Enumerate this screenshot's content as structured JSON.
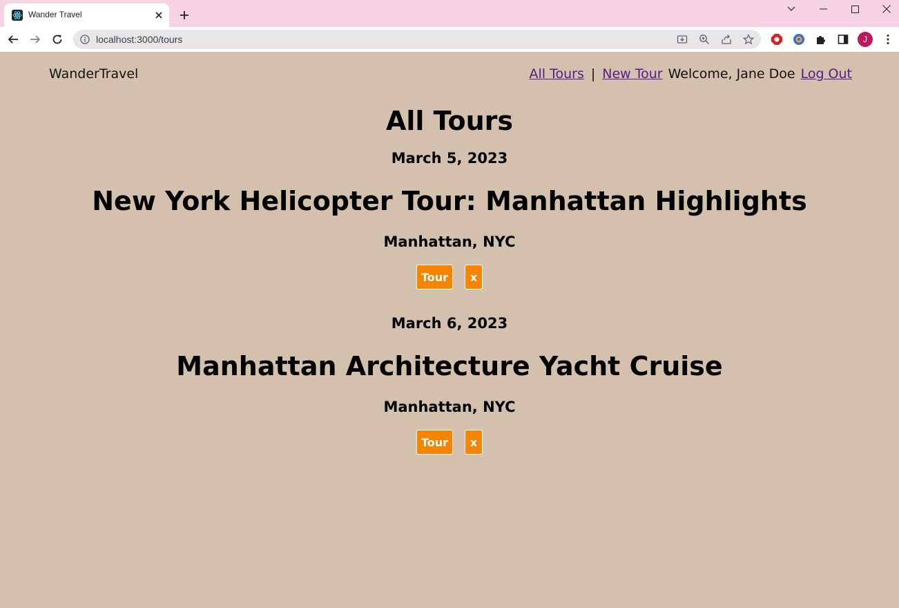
{
  "browser": {
    "tab_title": "Wander Travel",
    "url": "localhost:3000/tours",
    "avatar_initial": "J"
  },
  "header": {
    "brand": "WanderTravel",
    "nav_all_tours": "All Tours",
    "separator": "|",
    "nav_new_tour": "New Tour",
    "welcome": "Welcome, Jane Doe",
    "logout": "Log Out"
  },
  "main": {
    "title": "All Tours",
    "tours": [
      {
        "date": "March 5, 2023",
        "name": "New York Helicopter Tour: Manhattan Highlights",
        "location": "Manhattan, NYC",
        "tour_button": "Tour",
        "delete_button": "x"
      },
      {
        "date": "March 6, 2023",
        "name": "Manhattan Architecture Yacht Cruise",
        "location": "Manhattan, NYC",
        "tour_button": "Tour",
        "delete_button": "x"
      }
    ]
  },
  "colors": {
    "page_background": "#d3c0ad",
    "button_background": "#f58400",
    "link": "#551a8b",
    "tabstrip": "#f6d3e4"
  }
}
